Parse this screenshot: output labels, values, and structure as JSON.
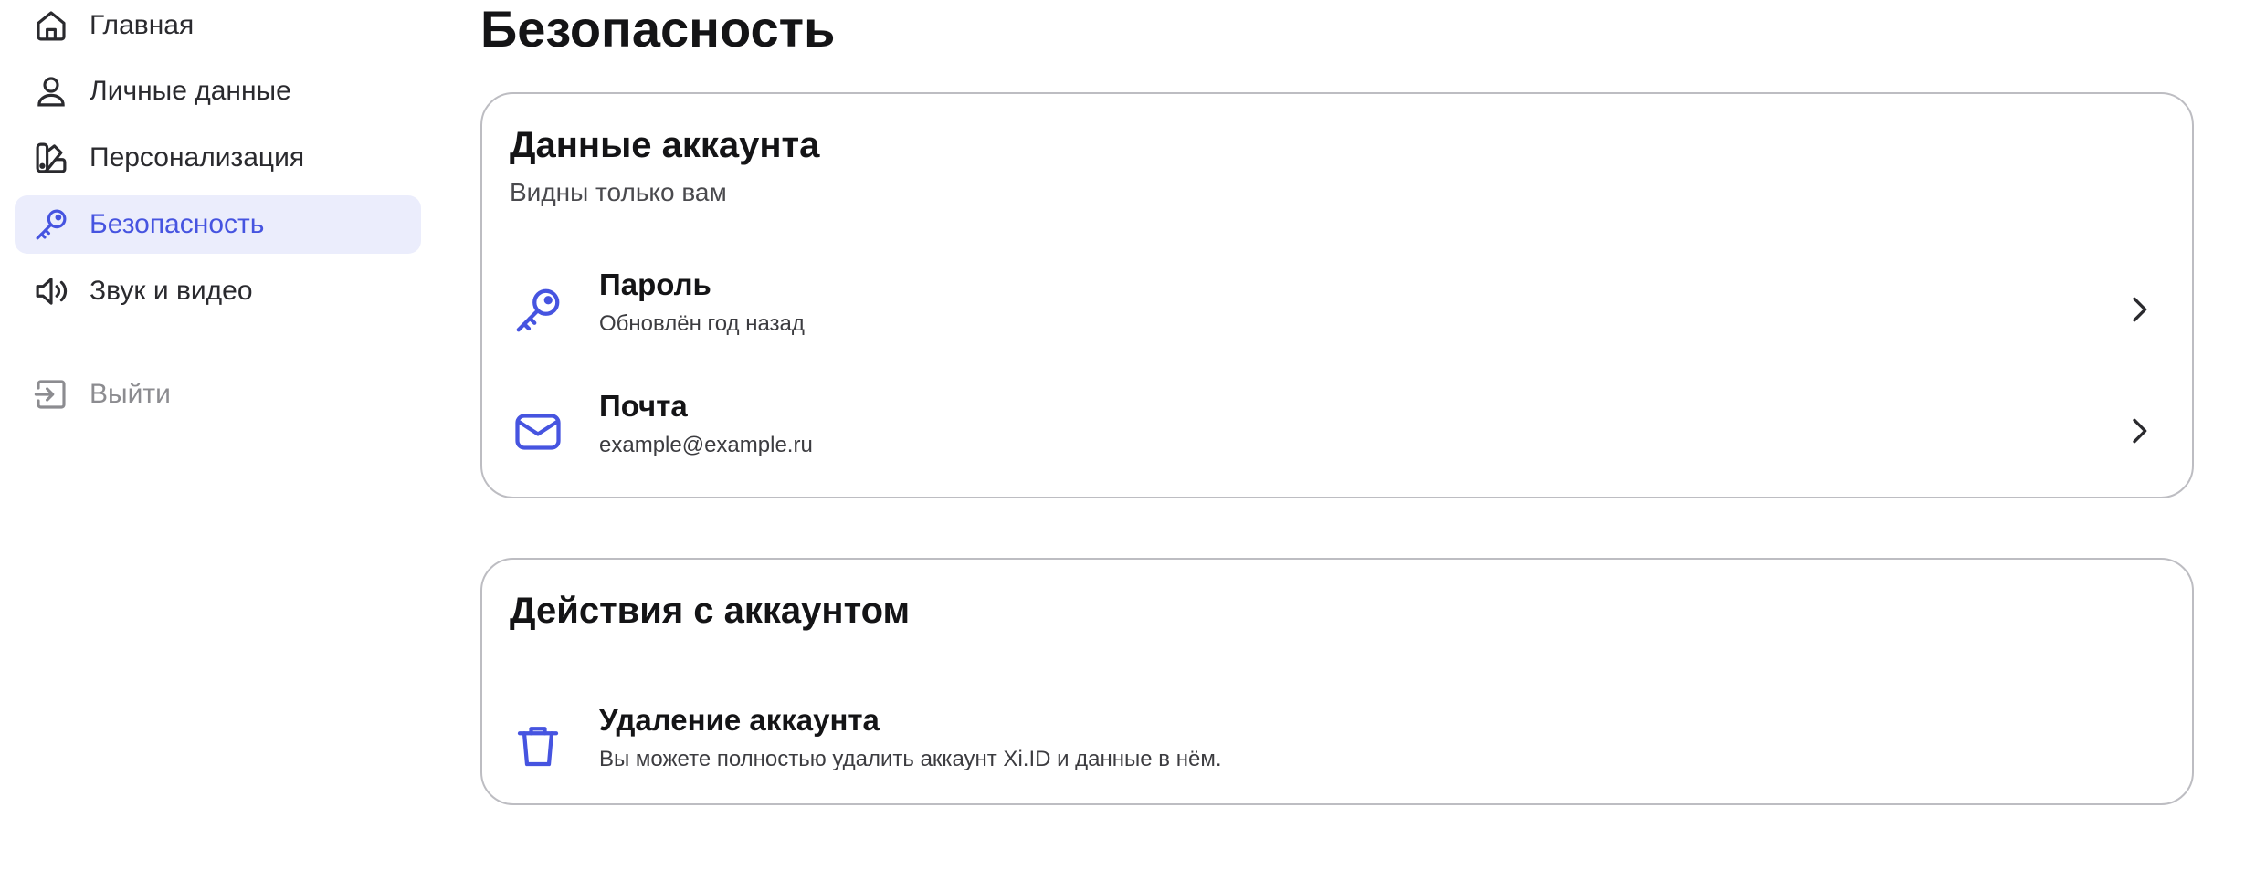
{
  "sidebar": {
    "items": [
      {
        "label": "Главная",
        "icon": "home-icon"
      },
      {
        "label": "Личные данные",
        "icon": "user-icon"
      },
      {
        "label": "Персонализация",
        "icon": "palette-icon"
      },
      {
        "label": "Безопасность",
        "icon": "key-icon",
        "active": true
      },
      {
        "label": "Звук и видео",
        "icon": "speaker-icon"
      }
    ],
    "logout": {
      "label": "Выйти",
      "icon": "logout-icon"
    }
  },
  "main": {
    "title": "Безопасность",
    "account_card": {
      "title": "Данные аккаунта",
      "subtitle": "Видны только вам",
      "rows": [
        {
          "title": "Пароль",
          "subtitle": "Обновлён год назад",
          "icon": "key-icon"
        },
        {
          "title": "Почта",
          "subtitle": "example@example.ru",
          "icon": "mail-icon"
        }
      ]
    },
    "actions_card": {
      "title": "Действия с аккаунтом",
      "rows": [
        {
          "title": "Удаление аккаунта",
          "subtitle": "Вы можете полностью удалить аккаунт Xi.ID и данные в нём.",
          "icon": "trash-icon"
        }
      ]
    }
  },
  "colors": {
    "accent": "#4654e0",
    "active_bg": "#ebedfc",
    "border": "#bdbdc2",
    "text": "#141416",
    "muted": "#8c8c90"
  }
}
